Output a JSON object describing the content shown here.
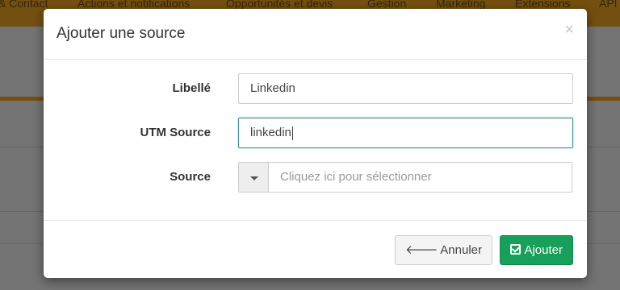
{
  "background": {
    "nav_items": [
      "& Contact",
      "Actions et notifications",
      "Opportunités et devis",
      "Gestion",
      "Marketing",
      "Extensions",
      "API"
    ]
  },
  "modal": {
    "title": "Ajouter une source",
    "close_symbol": "×",
    "fields": {
      "libelle": {
        "label": "Libellé",
        "value": "Linkedin"
      },
      "utm_source": {
        "label": "UTM Source",
        "value": "linkedin"
      },
      "source": {
        "label": "Source",
        "placeholder": "Cliquez ici pour sélectionner"
      }
    },
    "buttons": {
      "cancel": {
        "label": "Annuler",
        "icon": "arrow-left-icon"
      },
      "add": {
        "label": "Ajouter",
        "icon": "check-square-icon"
      }
    }
  },
  "colors": {
    "nav_background": "#e8a020",
    "primary_button": "#16a05a",
    "focus_border": "#3c8ea0"
  }
}
